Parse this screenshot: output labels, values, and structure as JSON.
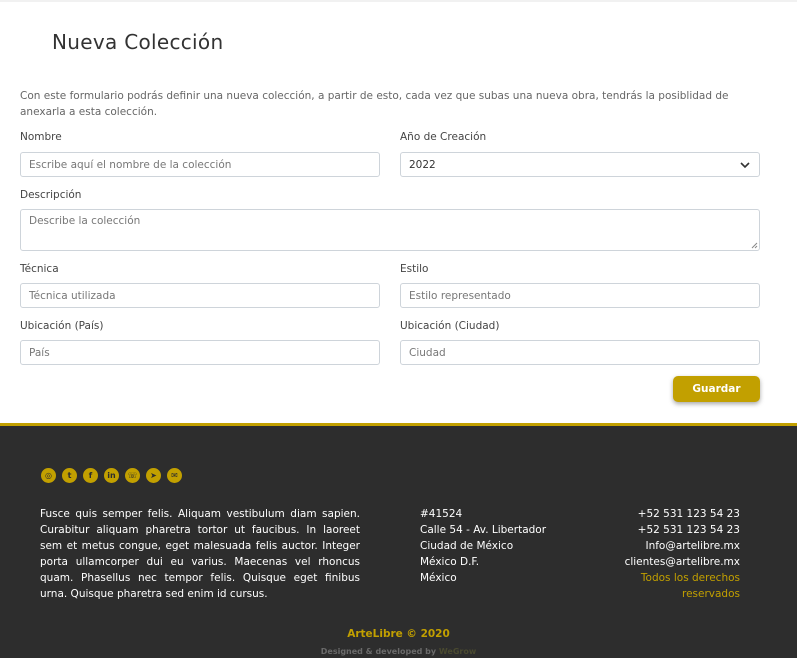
{
  "form": {
    "title": "Nueva Colección",
    "intro": "Con este formulario podrás definir una nueva colección, a partir de esto, cada vez que subas una nueva obra, tendrás la posiblidad de anexarla a esta colección.",
    "nombre": {
      "label": "Nombre",
      "placeholder": "Escribe aquí el nombre de la colección"
    },
    "anio": {
      "label": "Año de Creación",
      "value": "2022"
    },
    "descripcion": {
      "label": "Descripción",
      "placeholder": "Describe la colección"
    },
    "tecnica": {
      "label": "Técnica",
      "placeholder": "Técnica utilizada"
    },
    "estilo": {
      "label": "Estilo",
      "placeholder": "Estilo representado"
    },
    "pais": {
      "label": "Ubicación (País)",
      "placeholder": "País"
    },
    "ciudad": {
      "label": "Ubicación (Ciudad)",
      "placeholder": "Ciudad"
    },
    "save_label": "Guardar"
  },
  "footer": {
    "socials": [
      {
        "icon": "instagram-icon",
        "glyph": "◎"
      },
      {
        "icon": "twitter-icon",
        "glyph": "t"
      },
      {
        "icon": "facebook-icon",
        "glyph": "f"
      },
      {
        "icon": "linkedin-icon",
        "glyph": "in"
      },
      {
        "icon": "whatsapp-icon",
        "glyph": "☏"
      },
      {
        "icon": "telegram-icon",
        "glyph": "➤"
      },
      {
        "icon": "messenger-icon",
        "glyph": "✉"
      }
    ],
    "text": "Fusce quis semper felis. Aliquam vestibulum diam sapien. Curabitur aliquam pharetra tortor ut faucibus. In laoreet sem et metus congue, eget malesuada felis auctor. Integer porta ullamcorper dui eu varius. Maecenas vel rhoncus quam. Phasellus nec tempor felis. Quisque eget finibus urna. Quisque pharetra sed enim id cursus.",
    "address": [
      "#41524",
      "Calle 54 - Av. Libertador",
      "Ciudad de México",
      "México D.F.",
      "México"
    ],
    "phone1": "+52 531 123 54 23",
    "phone2": "+52 531 123 54 23",
    "email1": "Info@artelibre.mx",
    "email2": "clientes@artelibre.mx",
    "rights": "Todos los derechos reservados",
    "copyright": "ArteLibre © 2020",
    "credit_prefix": "Designed & developed by ",
    "credit_brand": "WeGrow"
  },
  "colors": {
    "accent": "#c2a000",
    "footer_bg": "#2d2d2d"
  }
}
